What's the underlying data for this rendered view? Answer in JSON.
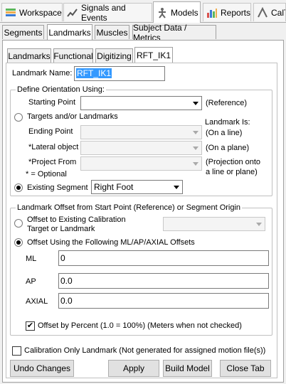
{
  "top_tabs": [
    {
      "label": "Workspace",
      "icon": "workspace-icon"
    },
    {
      "label": "Signals and Events",
      "icon": "signals-icon"
    },
    {
      "label": "Models",
      "icon": "models-icon"
    },
    {
      "label": "Reports",
      "icon": "reports-icon"
    },
    {
      "label": "CalT",
      "icon": "calt-icon"
    }
  ],
  "sub_tabs": [
    "Segments",
    "Landmarks",
    "Muscles",
    "Subject Data / Metrics"
  ],
  "inner_tabs": [
    "Landmarks",
    "Functional",
    "Digitizing",
    "RFT_IK1"
  ],
  "landmark_name": {
    "label": "Landmark Name:",
    "value": "RFT_IK1"
  },
  "orientation": {
    "legend": "Define Orientation Using:",
    "starting_point_label": "Starting Point",
    "reference_note": "(Reference)",
    "targets_label": "Targets and/or Landmarks",
    "landmark_is": "Landmark Is:",
    "ending_point_label": "Ending Point",
    "on_line": "(On a line)",
    "lateral_label": "*Lateral object",
    "on_plane": "(On a plane)",
    "project_label": "*Project From",
    "projection_note_1": "(Projection onto",
    "projection_note_2": "a line or plane)",
    "optional_note": "* = Optional",
    "existing_segment_label": "Existing Segment",
    "existing_segment_value": "Right Foot"
  },
  "offset": {
    "legend": "Landmark Offset from Start Point (Reference) or Segment Origin",
    "calib_label_1": "Offset to Existing Calibration",
    "calib_label_2": "Target or Landmark",
    "mlap_label": "Offset Using the Following ML/AP/AXIAL Offsets",
    "ml_label": "ML",
    "ml_value": "0",
    "ap_label": "AP",
    "ap_value": "0.0",
    "axial_label": "AXIAL",
    "axial_value": "0.0",
    "percent_label": "Offset by Percent (1.0 = 100%) (Meters when not checked)"
  },
  "calib_only_label": "Calibration Only Landmark (Not generated for assigned motion file(s))",
  "buttons": {
    "undo": "Undo Changes",
    "apply": "Apply",
    "build": "Build Model",
    "close": "Close Tab"
  },
  "check_glyph": "✔"
}
